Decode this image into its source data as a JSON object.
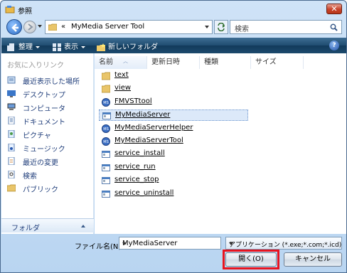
{
  "window": {
    "title": "参照",
    "close_label": "✕"
  },
  "address": {
    "chevron": "«",
    "path": "MyMedia Server Tool"
  },
  "search": {
    "placeholder": "検索"
  },
  "toolbar": {
    "organize": "整理",
    "views": "表示",
    "new_folder": "新しいフォルダ",
    "help": "?"
  },
  "leftpane": {
    "header": "お気に入りリンク",
    "items": [
      "最近表示した場所",
      "デスクトップ",
      "コンピュータ",
      "ドキュメント",
      "ピクチャ",
      "ミュージック",
      "最近の変更",
      "検索",
      "パブリック"
    ],
    "folder_bar": "フォルダ"
  },
  "columns": [
    "名前",
    "更新日時",
    "種類",
    "サイズ"
  ],
  "files": [
    {
      "name": "text",
      "type": "folder"
    },
    {
      "name": "view",
      "type": "folder"
    },
    {
      "name": "FMVSTtool",
      "type": "app-ms"
    },
    {
      "name": "MyMediaServer",
      "type": "app-window",
      "selected": true
    },
    {
      "name": "MyMediaServerHelper",
      "type": "app-ms"
    },
    {
      "name": "MyMediaServerTool",
      "type": "app-ms"
    },
    {
      "name": "service_install",
      "type": "app-window"
    },
    {
      "name": "service_run",
      "type": "app-window"
    },
    {
      "name": "service_stop",
      "type": "app-window"
    },
    {
      "name": "service_uninstall",
      "type": "app-window"
    }
  ],
  "bottom": {
    "filename_label": "ファイル名(N):",
    "filename_value": "MyMediaServer",
    "filetype_value": "アプリケーション (*.exe;*.com;*.icd)",
    "open_label": "開く(O)",
    "cancel_label": "キャンセル"
  },
  "colors": {
    "highlight": "#e8141f",
    "toolbar": "#1f4c70",
    "link": "#1f3d7a"
  }
}
